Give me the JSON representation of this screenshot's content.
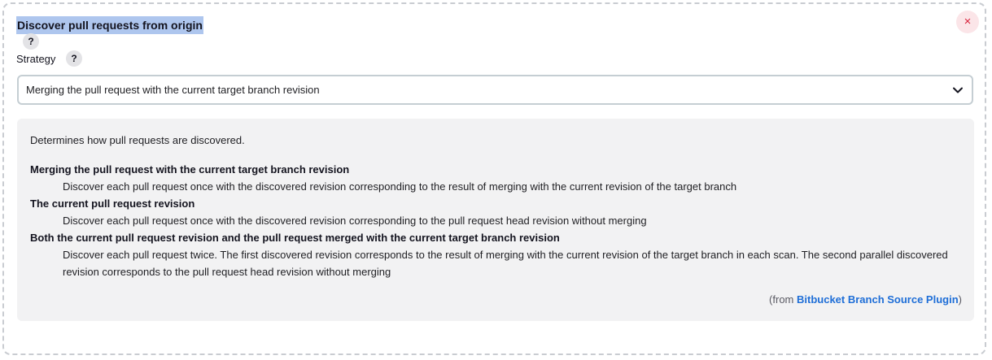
{
  "section": {
    "title": "Discover pull requests from origin",
    "help_symbol": "?",
    "close_symbol": "×"
  },
  "strategy": {
    "label": "Strategy",
    "help_symbol": "?",
    "selected_value": "Merging the pull request with the current target branch revision"
  },
  "help": {
    "intro": "Determines how pull requests are discovered.",
    "options": [
      {
        "term": "Merging the pull request with the current target branch revision",
        "description": "Discover each pull request once with the discovered revision corresponding to the result of merging with the current revision of the target branch"
      },
      {
        "term": "The current pull request revision",
        "description": "Discover each pull request once with the discovered revision corresponding to the pull request head revision without merging"
      },
      {
        "term": "Both the current pull request revision and the pull request merged with the current target branch revision",
        "description": "Discover each pull request twice. The first discovered revision corresponds to the result of merging with the current revision of the target branch in each scan. The second parallel discovered revision corresponds to the pull request head revision without merging"
      }
    ],
    "from_prefix": "(from ",
    "from_link": "Bitbucket Branch Source Plugin",
    "from_suffix": ")"
  },
  "icons": {
    "close": "close-icon",
    "chevron": "chevron-down-icon",
    "help": "help-icon"
  },
  "colors": {
    "title_highlight": "#aec6ee",
    "close_bg": "#fbe5e8",
    "close_fg": "#d8203a",
    "link": "#1e6ed7",
    "panel_bg": "#f2f2f3"
  }
}
